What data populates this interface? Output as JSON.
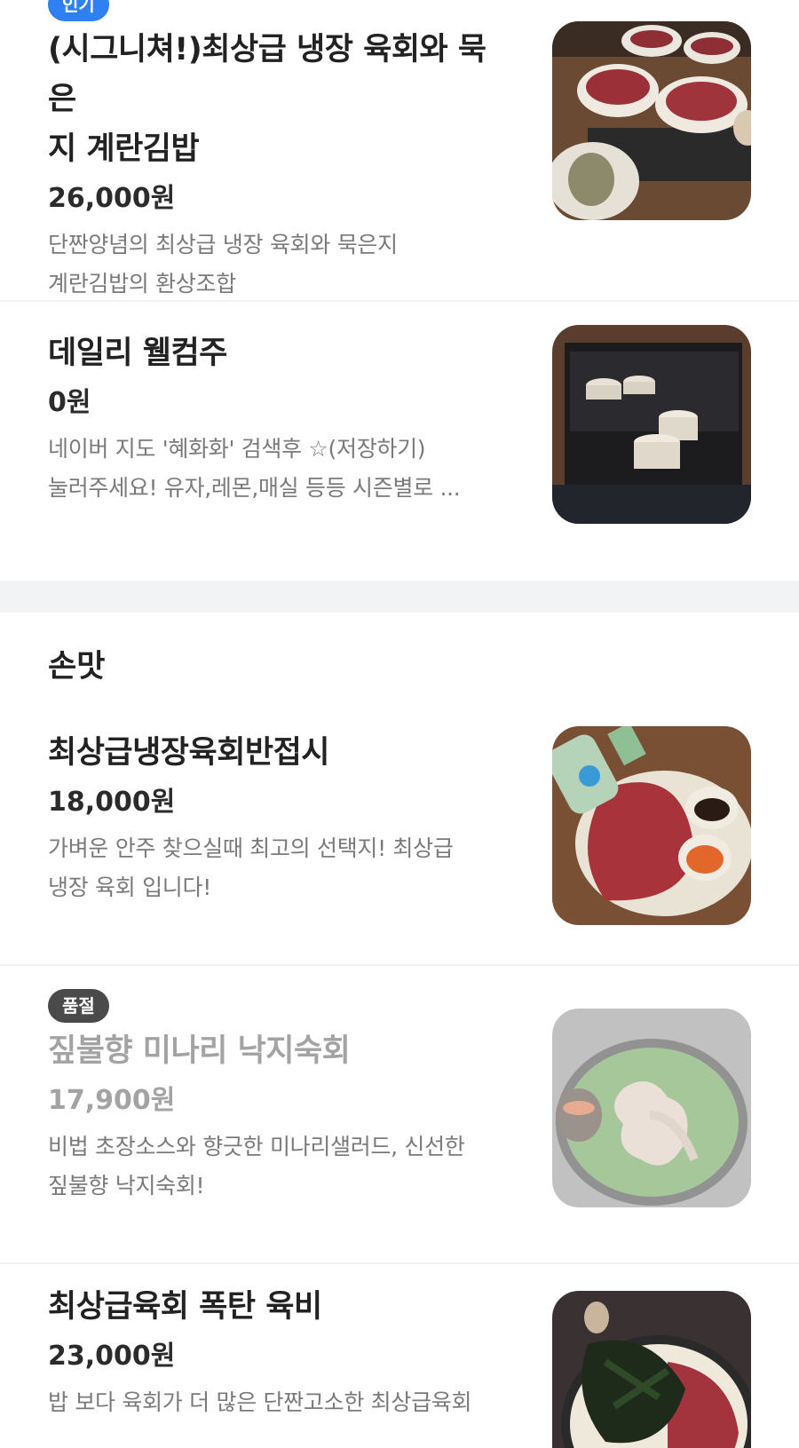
{
  "top_section": {
    "items": [
      {
        "badge": "인기",
        "name_lines": [
          "(시그니쳐!)최상급 냉장 육회와 묵은",
          "지 계란김밥"
        ],
        "price": "26,000원",
        "desc_lines": [
          "단짠양념의 최상급 냉장 육회와 묵은지",
          "계란김밥의 환상조합"
        ]
      },
      {
        "name_lines": [
          "데일리 웰컴주"
        ],
        "price": "0원",
        "desc_lines": [
          "네이버 지도 '혜화화' 검색후 ☆(저장하기)",
          "눌러주세요! 유자,레몬,매실 등등 시즌별로 ..."
        ]
      }
    ]
  },
  "section": {
    "title": "손맛",
    "items": [
      {
        "name_lines": [
          "최상급냉장육회반접시"
        ],
        "price": "18,000원",
        "desc_lines": [
          "가벼운 안주 찾으실때 최고의 선택지! 최상급",
          "냉장 육회 입니다!"
        ]
      },
      {
        "badge": "품절",
        "name_lines": [
          "짚불향 미나리 낙지숙회"
        ],
        "price": "17,900원",
        "desc_lines": [
          "비법 초장소스와 향긋한 미나리샐러드, 신선한",
          "짚불향 낙지숙회!"
        ]
      },
      {
        "name_lines": [
          "최상급육회 폭탄 육비"
        ],
        "price": "23,000원",
        "desc_lines": [
          "밥 보다 육회가 더 많은 단짠고소한 최상급육회"
        ]
      }
    ]
  },
  "colors": {
    "badge_popular": "#2f80f0",
    "badge_soldout": "#4a4a4a",
    "section_gap": "#f2f3f5"
  }
}
